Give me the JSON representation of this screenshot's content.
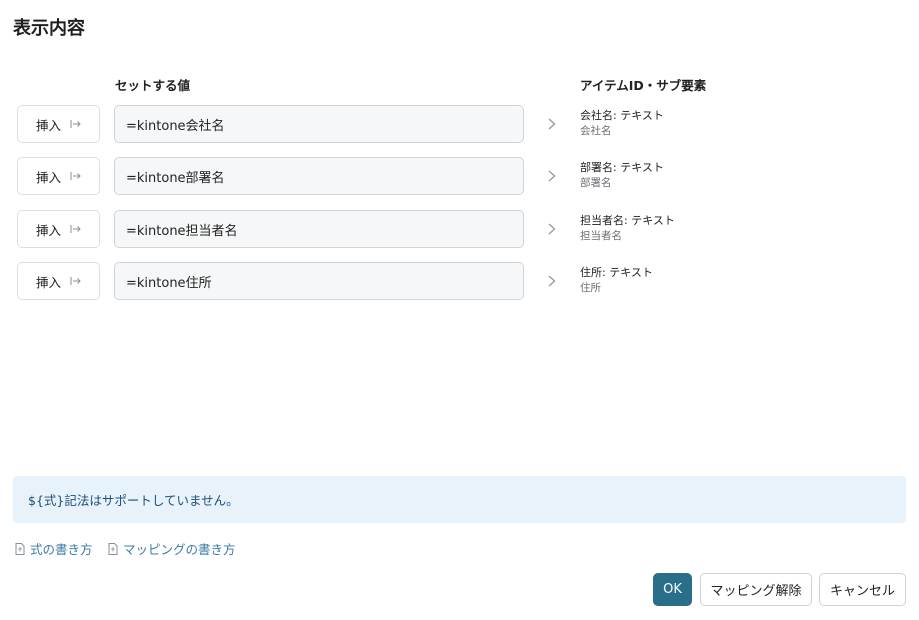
{
  "dialog": {
    "title": "表示内容",
    "columns": {
      "value_header": "セットする値",
      "item_header": "アイテムID・サブ要素"
    },
    "rows": [
      {
        "insert_label": "挿入",
        "value": "=kintone会社名",
        "item_title": "会社名: テキスト",
        "item_sub": "会社名"
      },
      {
        "insert_label": "挿入",
        "value": "=kintone部署名",
        "item_title": "部署名: テキスト",
        "item_sub": "部署名"
      },
      {
        "insert_label": "挿入",
        "value": "=kintone担当者名",
        "item_title": "担当者名: テキスト",
        "item_sub": "担当者名"
      },
      {
        "insert_label": "挿入",
        "value": "=kintone住所",
        "item_title": "住所: テキスト",
        "item_sub": "住所"
      }
    ],
    "notice": "${式}記法はサポートしていません。",
    "links": {
      "formula_help": "式の書き方",
      "mapping_help": "マッピングの書き方"
    },
    "buttons": {
      "ok": "OK",
      "unmap": "マッピング解除",
      "cancel": "キャンセル"
    },
    "icons": {
      "insert": "insert-arrow-icon",
      "row": "chevron-right-icon",
      "link": "document-icon"
    },
    "colors": {
      "primary": "#2a6f89",
      "notice_bg": "#e8f2fb",
      "link": "#3a7aa6"
    }
  }
}
